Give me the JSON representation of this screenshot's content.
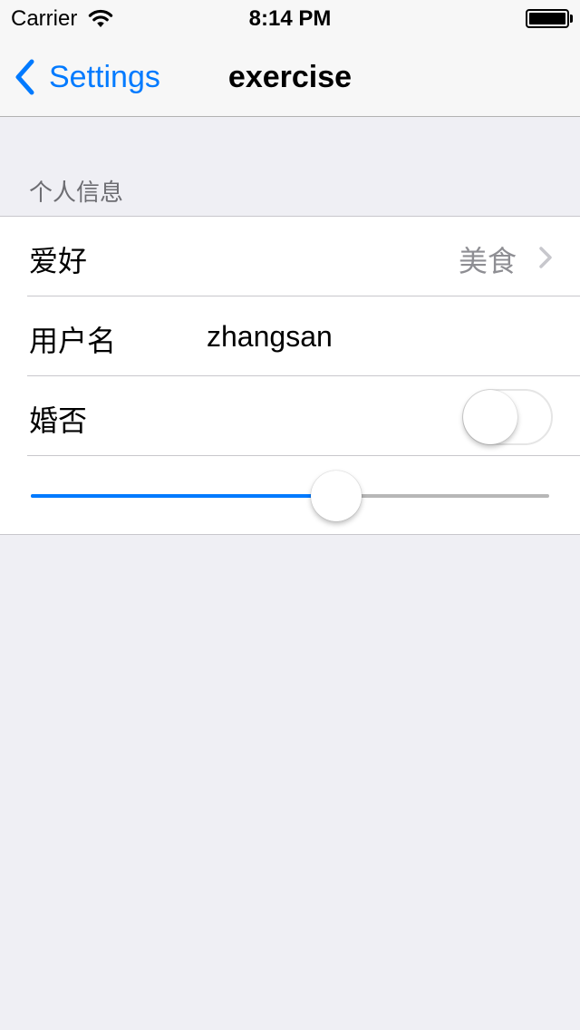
{
  "status_bar": {
    "carrier": "Carrier",
    "time": "8:14 PM",
    "wifi_icon": "wifi-icon",
    "battery_icon": "battery-icon",
    "battery_level": 1.0
  },
  "nav": {
    "back_label": "Settings",
    "back_icon": "chevron-left-icon",
    "title": "exercise",
    "accent_color": "#007aff"
  },
  "section": {
    "header": "个人信息",
    "rows": {
      "hobby": {
        "label": "爱好",
        "detail": "美食",
        "icon": "chevron-right-icon"
      },
      "username": {
        "label": "用户名",
        "value": "zhangsan",
        "placeholder": ""
      },
      "married": {
        "label": "婚否",
        "on": false
      }
    },
    "slider": {
      "value": 0.59,
      "min": 0,
      "max": 1
    }
  },
  "colors": {
    "background": "#efeff4",
    "bars": "#f7f7f7",
    "separator": "#c8c7cc",
    "secondary_text": "#8e8e93",
    "track": "#b7b7b7"
  }
}
